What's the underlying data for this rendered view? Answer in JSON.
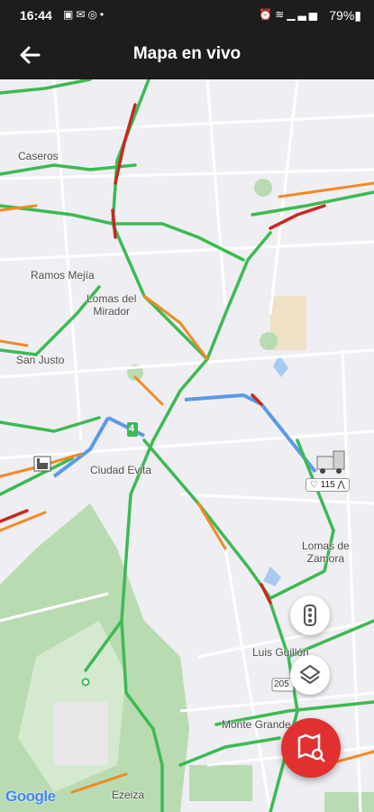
{
  "status_bar": {
    "time": "16:44",
    "battery": "79%",
    "left_icons": [
      "image-icon",
      "gmail-icon",
      "whatsapp-icon",
      "dot-icon"
    ],
    "right_icons": [
      "alarm-icon",
      "wifi-icon",
      "signal-icon",
      "battery-icon"
    ]
  },
  "app_bar": {
    "title": "Mapa en vivo",
    "back_icon": "arrow-left-icon"
  },
  "map": {
    "places": {
      "caseros": "Caseros",
      "ramos_mejia": "Ramos Mejía",
      "lomas_del_mirador": "Lomas del\nMirador",
      "san_justo": "San Justo",
      "ciudad_evita": "Ciudad Evita",
      "lomas_de_zamora": "Lomas de\nZamora",
      "luis_guillon": "Luis Guillón",
      "monte_grande": "Monte Grande",
      "ezeiza": "Ezeiza"
    },
    "route_shield_4": "4",
    "route_shield_205": "205",
    "vehicle": {
      "icon": "truck-icon",
      "speed_label": "115"
    },
    "controls": {
      "traffic_icon": "traffic-light-icon",
      "layers_icon": "layers-icon",
      "map_search_icon": "map-search-icon"
    },
    "attribution": "Google",
    "colors": {
      "traffic_green": "#3cba54",
      "traffic_orange": "#f08a24",
      "traffic_red": "#c8281e",
      "route_blue": "#5a9be8",
      "park_green": "#b7dcb0",
      "accent_red": "#e03030"
    }
  }
}
